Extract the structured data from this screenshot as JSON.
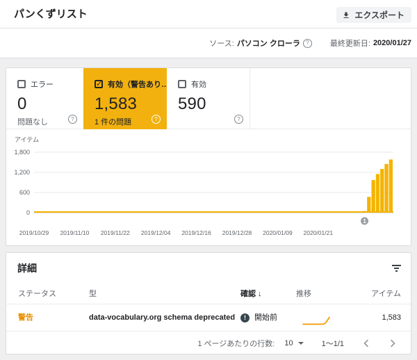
{
  "colors": {
    "amber_card": "#F2B10E",
    "bar": "#F4B400",
    "warning_text": "#EA8F00",
    "sparkline": "#F29900",
    "grid": "#E8EAED",
    "axis": "#BDC1C6",
    "tick_text": "#5F6368",
    "marker": "#9AA0A6"
  },
  "header": {
    "title": "パンくずリスト",
    "export_label": "エクスポート",
    "source_label": "ソース:",
    "source_value": "パソコン クローラ",
    "last_updated_label": "最終更新日:",
    "last_updated_value": "2020/01/27"
  },
  "cards": [
    {
      "label": "エラー",
      "value": "0",
      "subtitle": "問題なし",
      "checked": false,
      "selected": false
    },
    {
      "label": "有効（警告あり…",
      "value": "1,583",
      "subtitle": "1 件の問題",
      "checked": true,
      "selected": true
    },
    {
      "label": "有効",
      "value": "590",
      "subtitle": "",
      "checked": false,
      "selected": false
    }
  ],
  "chart_data": {
    "type": "bar",
    "ylabel": "アイテム",
    "ylim": [
      0,
      1800
    ],
    "y_ticks": [
      0,
      600,
      1200,
      1800
    ],
    "y_tick_labels": [
      "0",
      "600",
      "1,200",
      "1,800"
    ],
    "x_tick_labels": [
      "2019/10/29",
      "2019/11/10",
      "2019/11/22",
      "2019/12/04",
      "2019/12/16",
      "2019/12/28",
      "2020/01/09",
      "2020/01/21"
    ],
    "x_range": [
      "2019/10/29",
      "2020/01/26"
    ],
    "series_name": "有効（警告あり）",
    "values_zero_through": "2020/01/19",
    "bars": [
      {
        "date": "2020/01/20",
        "value": 50
      },
      {
        "date": "2020/01/21",
        "value": 470
      },
      {
        "date": "2020/01/22",
        "value": 970
      },
      {
        "date": "2020/01/23",
        "value": 1150
      },
      {
        "date": "2020/01/24",
        "value": 1300
      },
      {
        "date": "2020/01/25",
        "value": 1450
      },
      {
        "date": "2020/01/26",
        "value": 1583
      }
    ],
    "annotation": {
      "label": "1",
      "bar_index": 0
    },
    "grid": true,
    "legend": false
  },
  "details": {
    "title": "詳細",
    "columns": {
      "status": "ステータス",
      "type": "型",
      "validation": "確認",
      "trend": "推移",
      "items": "アイテム"
    },
    "sort": {
      "column": "確認",
      "direction_arrow": "↓"
    },
    "rows": [
      {
        "status": "警告",
        "type": "data-vocabulary.org schema deprecated",
        "validation": "開始前",
        "trend_shape": "flat-then-rising",
        "items": "1,583"
      }
    ],
    "pagination": {
      "rows_per_page_label": "1 ページあたりの行数:",
      "rows_per_page": "10",
      "range": "1～1/1"
    }
  }
}
